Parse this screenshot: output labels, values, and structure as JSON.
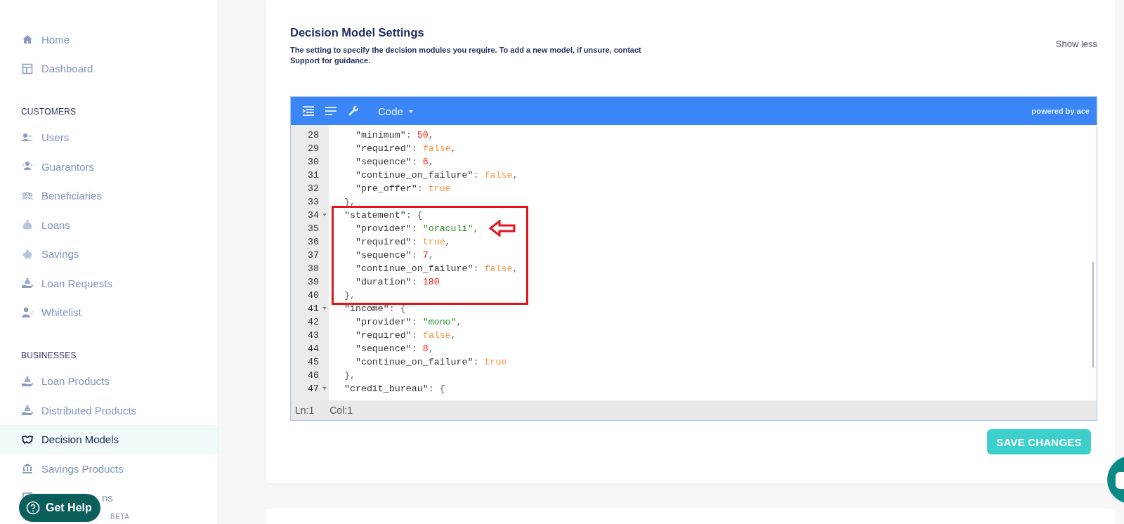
{
  "sidebar": {
    "groups": [
      {
        "items": [
          {
            "label": "Home",
            "selected": false
          },
          {
            "label": "Dashboard",
            "selected": false
          }
        ]
      },
      {
        "heading": "CUSTOMERS",
        "items": [
          {
            "label": "Users",
            "selected": false
          },
          {
            "label": "Guarantors",
            "selected": false
          },
          {
            "label": "Beneficiaries",
            "selected": false
          },
          {
            "label": "Loans",
            "selected": false
          },
          {
            "label": "Savings",
            "selected": false
          },
          {
            "label": "Loan Requests",
            "selected": false
          },
          {
            "label": "Whitelist",
            "selected": false
          }
        ]
      },
      {
        "heading": "BUSINESSES",
        "items": [
          {
            "label": "Loan Products",
            "selected": false
          },
          {
            "label": "Distributed Products",
            "selected": false
          },
          {
            "label": "Decision Models",
            "selected": true
          },
          {
            "label": "Savings Products",
            "selected": false
          },
          {
            "label": "ns",
            "selected": false
          },
          {
            "badge": "BETA",
            "selected": false
          }
        ]
      }
    ]
  },
  "help_button": {
    "label": "Get Help"
  },
  "settings": {
    "title": "Decision Model Settings",
    "description": "The setting to specify the decision modules you require. To add a new model, if unsure, contact Support for guidance.",
    "toggle": "Show less",
    "editor": {
      "toolbar": {
        "mode": "Code",
        "credit": "powered by ace"
      },
      "lines": [
        {
          "number": "28",
          "foldable": false,
          "tokens": [
            {
              "kind": "key",
              "text": "    \"minimum\""
            },
            {
              "kind": "punct",
              "text": ": "
            },
            {
              "kind": "number",
              "text": "50"
            },
            {
              "kind": "punct",
              "text": ","
            }
          ]
        },
        {
          "number": "29",
          "foldable": false,
          "tokens": [
            {
              "kind": "key",
              "text": "    \"required\""
            },
            {
              "kind": "punct",
              "text": ": "
            },
            {
              "kind": "boolean",
              "text": "false"
            },
            {
              "kind": "punct",
              "text": ","
            }
          ]
        },
        {
          "number": "30",
          "foldable": false,
          "tokens": [
            {
              "kind": "key",
              "text": "    \"sequence\""
            },
            {
              "kind": "punct",
              "text": ": "
            },
            {
              "kind": "number",
              "text": "6"
            },
            {
              "kind": "punct",
              "text": ","
            }
          ]
        },
        {
          "number": "31",
          "foldable": false,
          "tokens": [
            {
              "kind": "key",
              "text": "    \"continue_on_failure\""
            },
            {
              "kind": "punct",
              "text": ": "
            },
            {
              "kind": "boolean",
              "text": "false"
            },
            {
              "kind": "punct",
              "text": ","
            }
          ]
        },
        {
          "number": "32",
          "foldable": false,
          "tokens": [
            {
              "kind": "key",
              "text": "    \"pre_offer\""
            },
            {
              "kind": "punct",
              "text": ": "
            },
            {
              "kind": "boolean",
              "text": "true"
            }
          ]
        },
        {
          "number": "33",
          "foldable": false,
          "tokens": [
            {
              "kind": "punct",
              "text": "  },"
            }
          ]
        },
        {
          "number": "34",
          "foldable": true,
          "tokens": [
            {
              "kind": "key",
              "text": "  \"statement\""
            },
            {
              "kind": "punct",
              "text": ": {"
            }
          ]
        },
        {
          "number": "35",
          "foldable": false,
          "tokens": [
            {
              "kind": "key",
              "text": "    \"provider\""
            },
            {
              "kind": "punct",
              "text": ": "
            },
            {
              "kind": "string",
              "text": "\"oraculi\""
            },
            {
              "kind": "punct",
              "text": ","
            }
          ]
        },
        {
          "number": "36",
          "foldable": false,
          "tokens": [
            {
              "kind": "key",
              "text": "    \"required\""
            },
            {
              "kind": "punct",
              "text": ": "
            },
            {
              "kind": "boolean",
              "text": "true"
            },
            {
              "kind": "punct",
              "text": ","
            }
          ]
        },
        {
          "number": "37",
          "foldable": false,
          "tokens": [
            {
              "kind": "key",
              "text": "    \"sequence\""
            },
            {
              "kind": "punct",
              "text": ": "
            },
            {
              "kind": "number",
              "text": "7"
            },
            {
              "kind": "punct",
              "text": ","
            }
          ]
        },
        {
          "number": "38",
          "foldable": false,
          "tokens": [
            {
              "kind": "key",
              "text": "    \"continue_on_failure\""
            },
            {
              "kind": "punct",
              "text": ": "
            },
            {
              "kind": "boolean",
              "text": "false"
            },
            {
              "kind": "punct",
              "text": ","
            }
          ]
        },
        {
          "number": "39",
          "foldable": false,
          "tokens": [
            {
              "kind": "key",
              "text": "    \"duration\""
            },
            {
              "kind": "punct",
              "text": ": "
            },
            {
              "kind": "number",
              "text": "180"
            }
          ]
        },
        {
          "number": "40",
          "foldable": false,
          "tokens": [
            {
              "kind": "punct",
              "text": "  },"
            }
          ]
        },
        {
          "number": "41",
          "foldable": true,
          "tokens": [
            {
              "kind": "key",
              "text": "  \"income\""
            },
            {
              "kind": "punct",
              "text": ": {"
            }
          ]
        },
        {
          "number": "42",
          "foldable": false,
          "tokens": [
            {
              "kind": "key",
              "text": "    \"provider\""
            },
            {
              "kind": "punct",
              "text": ": "
            },
            {
              "kind": "string",
              "text": "\"mono\""
            },
            {
              "kind": "punct",
              "text": ","
            }
          ]
        },
        {
          "number": "43",
          "foldable": false,
          "tokens": [
            {
              "kind": "key",
              "text": "    \"required\""
            },
            {
              "kind": "punct",
              "text": ": "
            },
            {
              "kind": "boolean",
              "text": "false"
            },
            {
              "kind": "punct",
              "text": ","
            }
          ]
        },
        {
          "number": "44",
          "foldable": false,
          "tokens": [
            {
              "kind": "key",
              "text": "    \"sequence\""
            },
            {
              "kind": "punct",
              "text": ": "
            },
            {
              "kind": "number",
              "text": "8"
            },
            {
              "kind": "punct",
              "text": ","
            }
          ]
        },
        {
          "number": "45",
          "foldable": false,
          "tokens": [
            {
              "kind": "key",
              "text": "    \"continue_on_failure\""
            },
            {
              "kind": "punct",
              "text": ": "
            },
            {
              "kind": "boolean",
              "text": "true"
            }
          ]
        },
        {
          "number": "46",
          "foldable": false,
          "tokens": [
            {
              "kind": "punct",
              "text": "  },"
            }
          ]
        },
        {
          "number": "47",
          "foldable": true,
          "tokens": [
            {
              "kind": "key",
              "text": "  \"credit_bureau\""
            },
            {
              "kind": "punct",
              "text": ": {"
            }
          ]
        }
      ],
      "status": {
        "line": "Ln:1",
        "column": "Col:1"
      }
    },
    "save_button": "SAVE CHANGES"
  }
}
